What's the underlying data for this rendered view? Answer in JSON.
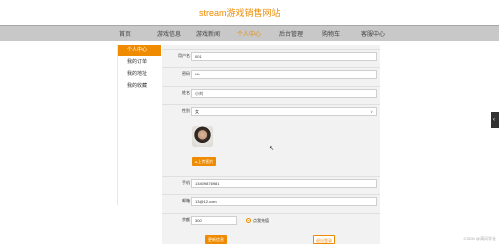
{
  "site": {
    "title": "stream游戏销售网站"
  },
  "nav": {
    "items": [
      {
        "label": "首页"
      },
      {
        "label": "游戏信息"
      },
      {
        "label": "游戏新闻"
      },
      {
        "label": "个人中心"
      },
      {
        "label": "后台管理"
      },
      {
        "label": "购物车"
      },
      {
        "label": "客服中心"
      }
    ],
    "active_index": 3
  },
  "sidebar": {
    "items": [
      {
        "label": "个人中心"
      },
      {
        "label": "我的订单"
      },
      {
        "label": "我的地址"
      },
      {
        "label": "我的收藏"
      }
    ]
  },
  "form": {
    "username": {
      "label": "用户名",
      "value": "001"
    },
    "password": {
      "label": "密码",
      "value": "***"
    },
    "name": {
      "label": "姓名",
      "value": "小刘"
    },
    "gender": {
      "label": "性别",
      "value": "女",
      "arrow": "∨"
    },
    "upload_label": "上传图片",
    "phone": {
      "label": "手机",
      "value": "13409876981"
    },
    "email": {
      "label": "邮箱",
      "value": "13@12.com"
    },
    "balance": {
      "label": "余额",
      "value": "300",
      "radio_label": "点我充值"
    }
  },
  "buttons": {
    "update": "更新信息",
    "logout": "退出登录"
  },
  "side_tab": {
    "icon": "‹"
  },
  "cursor_icon": "↖",
  "watermark": "CSDN @清风学长"
}
